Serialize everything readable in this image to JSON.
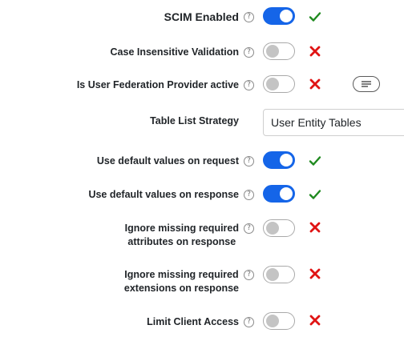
{
  "settings": [
    {
      "label": "SCIM Enabled",
      "enabled": true
    },
    {
      "label": "Case Insensitive Validation",
      "enabled": false
    },
    {
      "label": "Is User Federation Provider active",
      "enabled": false
    },
    {
      "label": "Table List Strategy",
      "value": "User Entity Tables"
    },
    {
      "label": "Use default values on request",
      "enabled": true
    },
    {
      "label": "Use default values on response",
      "enabled": true
    },
    {
      "label_line1": "Ignore missing required",
      "label_line2": "attributes on response",
      "enabled": false
    },
    {
      "label_line1": "Ignore missing required",
      "label_line2": "extensions on response",
      "enabled": false
    },
    {
      "label": "Limit Client Access",
      "enabled": false
    }
  ],
  "help_glyph": "?",
  "icons": {
    "help": "question-circle-icon",
    "enabled_status": "check-icon",
    "disabled_status": "x-icon",
    "notes": "text-lines-icon"
  },
  "colors": {
    "toggle_on": "#1565e8",
    "check": "#1f8a1f",
    "cross": "#e01414"
  }
}
